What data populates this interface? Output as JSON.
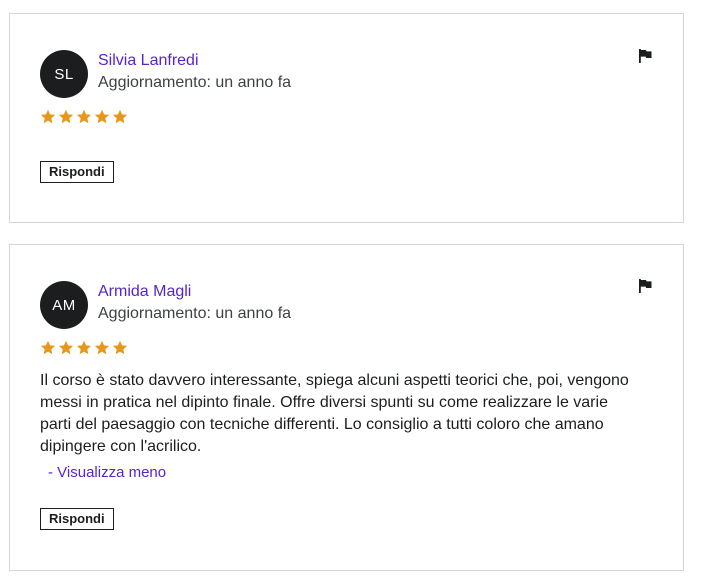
{
  "reviews": [
    {
      "initials": "SL",
      "name": "Silvia Lanfredi",
      "updated": "Aggiornamento: un anno fa",
      "rating": 5,
      "reply_label": "Rispondi"
    },
    {
      "initials": "AM",
      "name": "Armida Magli",
      "updated": "Aggiornamento: un anno fa",
      "rating": 5,
      "text_lines": [
        "Il corso è stato davvero interessante, spiega alcuni aspetti teorici che, poi, vengono",
        "messi in pratica nel dipinto finale. Offre diversi spunti su come realizzare le varie",
        "parti del paesaggio con tecniche differenti. Lo consiglio a tutti coloro che amano",
        "dipingere con l'acrilico."
      ],
      "toggle_label": "- Visualizza meno",
      "reply_label": "Rispondi"
    }
  ],
  "icons": {
    "flag": "flag-icon",
    "star": "star-icon"
  },
  "colors": {
    "accent": "#5624d0",
    "star": "#e59819",
    "avatar_bg": "#1c1d1f"
  }
}
